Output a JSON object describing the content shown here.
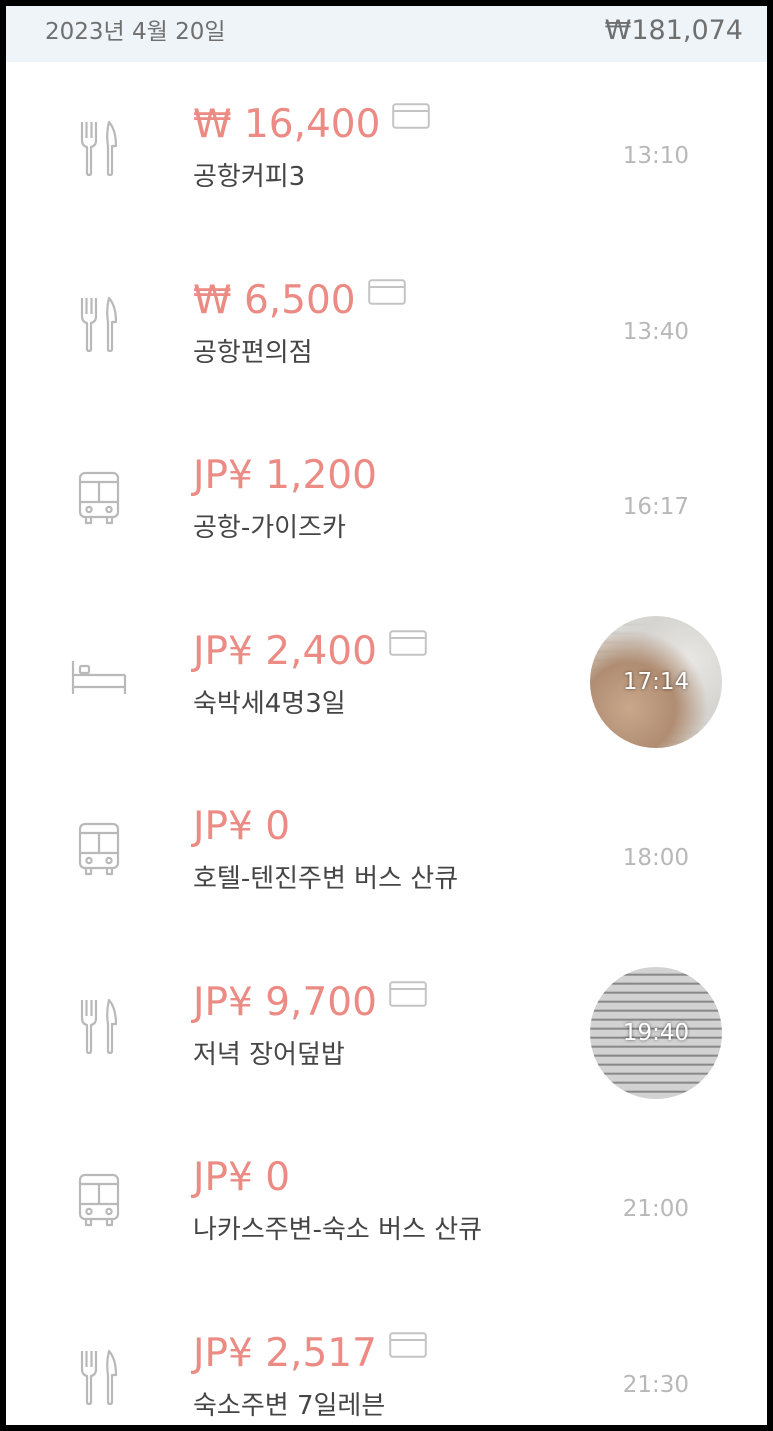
{
  "header": {
    "date": "2023년 4월 20일",
    "total": "₩181,074"
  },
  "colors": {
    "amount": "#ec8a84",
    "icon": "#b9b9b9",
    "header_bg": "#eef4f8",
    "time": "#b8b8b8"
  },
  "entries": [
    {
      "category_icon": "fork-knife-icon",
      "amount": "₩ 16,400",
      "card": true,
      "description": "공항커피3",
      "time": "13:10",
      "photo": false
    },
    {
      "category_icon": "fork-knife-icon",
      "amount": "₩ 6,500",
      "card": true,
      "description": "공항편의점",
      "time": "13:40",
      "photo": false
    },
    {
      "category_icon": "bus-icon",
      "amount": "JP¥ 1,200",
      "card": false,
      "description": "공항-가이즈카",
      "time": "16:17",
      "photo": false
    },
    {
      "category_icon": "bed-icon",
      "amount": "JP¥ 2,400",
      "card": true,
      "description": "숙박세4명3일",
      "time": "17:14",
      "photo": true
    },
    {
      "category_icon": "bus-icon",
      "amount": "JP¥ 0",
      "card": false,
      "description": "호텔-텐진주변 버스 산큐",
      "time": "18:00",
      "photo": false
    },
    {
      "category_icon": "fork-knife-icon",
      "amount": "JP¥ 9,700",
      "card": true,
      "description": "저녁 장어덮밥",
      "time": "19:40",
      "photo": true
    },
    {
      "category_icon": "bus-icon",
      "amount": "JP¥ 0",
      "card": false,
      "description": "나카스주변-숙소 버스 산큐",
      "time": "21:00",
      "photo": false
    },
    {
      "category_icon": "fork-knife-icon",
      "amount": "JP¥ 2,517",
      "card": true,
      "description": "숙소주변 7일레븐",
      "time": "21:30",
      "photo": false
    }
  ]
}
